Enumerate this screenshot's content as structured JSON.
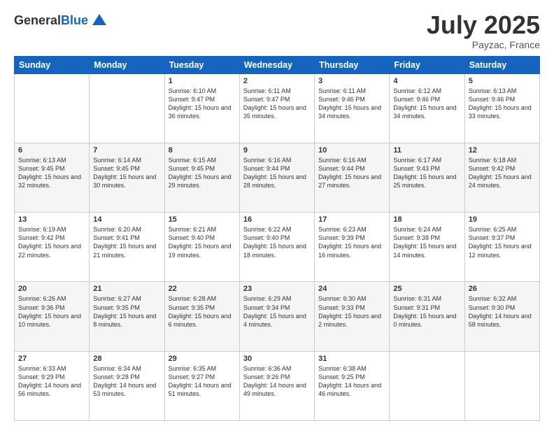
{
  "logo": {
    "general": "General",
    "blue": "Blue"
  },
  "title": "July 2025",
  "location": "Payzac, France",
  "days_of_week": [
    "Sunday",
    "Monday",
    "Tuesday",
    "Wednesday",
    "Thursday",
    "Friday",
    "Saturday"
  ],
  "weeks": [
    [
      {
        "day": "",
        "content": ""
      },
      {
        "day": "",
        "content": ""
      },
      {
        "day": "1",
        "content": "Sunrise: 6:10 AM\nSunset: 9:47 PM\nDaylight: 15 hours and 36 minutes."
      },
      {
        "day": "2",
        "content": "Sunrise: 6:11 AM\nSunset: 9:47 PM\nDaylight: 15 hours and 35 minutes."
      },
      {
        "day": "3",
        "content": "Sunrise: 6:11 AM\nSunset: 9:46 PM\nDaylight: 15 hours and 34 minutes."
      },
      {
        "day": "4",
        "content": "Sunrise: 6:12 AM\nSunset: 9:46 PM\nDaylight: 15 hours and 34 minutes."
      },
      {
        "day": "5",
        "content": "Sunrise: 6:13 AM\nSunset: 9:46 PM\nDaylight: 15 hours and 33 minutes."
      }
    ],
    [
      {
        "day": "6",
        "content": "Sunrise: 6:13 AM\nSunset: 9:45 PM\nDaylight: 15 hours and 32 minutes."
      },
      {
        "day": "7",
        "content": "Sunrise: 6:14 AM\nSunset: 9:45 PM\nDaylight: 15 hours and 30 minutes."
      },
      {
        "day": "8",
        "content": "Sunrise: 6:15 AM\nSunset: 9:45 PM\nDaylight: 15 hours and 29 minutes."
      },
      {
        "day": "9",
        "content": "Sunrise: 6:16 AM\nSunset: 9:44 PM\nDaylight: 15 hours and 28 minutes."
      },
      {
        "day": "10",
        "content": "Sunrise: 6:16 AM\nSunset: 9:44 PM\nDaylight: 15 hours and 27 minutes."
      },
      {
        "day": "11",
        "content": "Sunrise: 6:17 AM\nSunset: 9:43 PM\nDaylight: 15 hours and 25 minutes."
      },
      {
        "day": "12",
        "content": "Sunrise: 6:18 AM\nSunset: 9:42 PM\nDaylight: 15 hours and 24 minutes."
      }
    ],
    [
      {
        "day": "13",
        "content": "Sunrise: 6:19 AM\nSunset: 9:42 PM\nDaylight: 15 hours and 22 minutes."
      },
      {
        "day": "14",
        "content": "Sunrise: 6:20 AM\nSunset: 9:41 PM\nDaylight: 15 hours and 21 minutes."
      },
      {
        "day": "15",
        "content": "Sunrise: 6:21 AM\nSunset: 9:40 PM\nDaylight: 15 hours and 19 minutes."
      },
      {
        "day": "16",
        "content": "Sunrise: 6:22 AM\nSunset: 9:40 PM\nDaylight: 15 hours and 18 minutes."
      },
      {
        "day": "17",
        "content": "Sunrise: 6:23 AM\nSunset: 9:39 PM\nDaylight: 15 hours and 16 minutes."
      },
      {
        "day": "18",
        "content": "Sunrise: 6:24 AM\nSunset: 9:38 PM\nDaylight: 15 hours and 14 minutes."
      },
      {
        "day": "19",
        "content": "Sunrise: 6:25 AM\nSunset: 9:37 PM\nDaylight: 15 hours and 12 minutes."
      }
    ],
    [
      {
        "day": "20",
        "content": "Sunrise: 6:26 AM\nSunset: 9:36 PM\nDaylight: 15 hours and 10 minutes."
      },
      {
        "day": "21",
        "content": "Sunrise: 6:27 AM\nSunset: 9:35 PM\nDaylight: 15 hours and 8 minutes."
      },
      {
        "day": "22",
        "content": "Sunrise: 6:28 AM\nSunset: 9:35 PM\nDaylight: 15 hours and 6 minutes."
      },
      {
        "day": "23",
        "content": "Sunrise: 6:29 AM\nSunset: 9:34 PM\nDaylight: 15 hours and 4 minutes."
      },
      {
        "day": "24",
        "content": "Sunrise: 6:30 AM\nSunset: 9:33 PM\nDaylight: 15 hours and 2 minutes."
      },
      {
        "day": "25",
        "content": "Sunrise: 6:31 AM\nSunset: 9:31 PM\nDaylight: 15 hours and 0 minutes."
      },
      {
        "day": "26",
        "content": "Sunrise: 6:32 AM\nSunset: 9:30 PM\nDaylight: 14 hours and 58 minutes."
      }
    ],
    [
      {
        "day": "27",
        "content": "Sunrise: 6:33 AM\nSunset: 9:29 PM\nDaylight: 14 hours and 56 minutes."
      },
      {
        "day": "28",
        "content": "Sunrise: 6:34 AM\nSunset: 9:28 PM\nDaylight: 14 hours and 53 minutes."
      },
      {
        "day": "29",
        "content": "Sunrise: 6:35 AM\nSunset: 9:27 PM\nDaylight: 14 hours and 51 minutes."
      },
      {
        "day": "30",
        "content": "Sunrise: 6:36 AM\nSunset: 9:26 PM\nDaylight: 14 hours and 49 minutes."
      },
      {
        "day": "31",
        "content": "Sunrise: 6:38 AM\nSunset: 9:25 PM\nDaylight: 14 hours and 46 minutes."
      },
      {
        "day": "",
        "content": ""
      },
      {
        "day": "",
        "content": ""
      }
    ]
  ]
}
